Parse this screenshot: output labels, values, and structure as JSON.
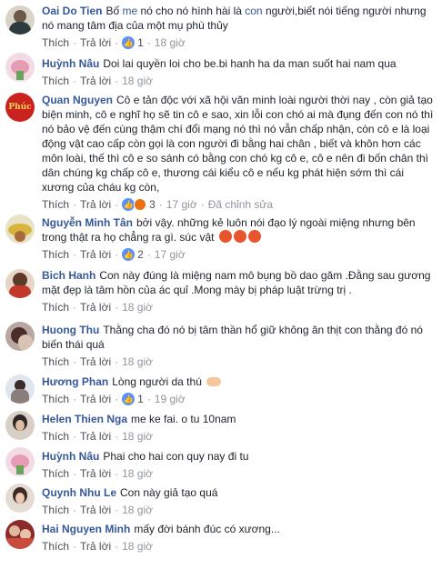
{
  "actions": {
    "like": "Thích",
    "reply": "Trả lời",
    "sep": "·",
    "edited": "Đã chỉnh sửa"
  },
  "comments": [
    {
      "author": "Oai Do Tien",
      "text_parts": [
        "Bố ",
        "me",
        " nó cho nó hình hài là ",
        "con",
        " người,biết nói tiếng người nhưng nó mang tâm địa của một mụ phù thủy"
      ],
      "like_count": "1",
      "time": "18 giờ"
    },
    {
      "author": "Huỳnh Nâu",
      "text": "Doi lai quyền loi cho be.bi hanh ha da man suốt hai nam qua",
      "time": "18 giờ"
    },
    {
      "author": "Quan Nguyen",
      "text": "Cô e tản độc với xã hội văn minh loài người thời nay , còn giả tạo biện minh, cô e nghĩ họ sẽ tin cô e sao, xin lỗi con chó ai mà đụng đến con nó thì nó bảo vệ đến cùng thậm chí đổi mạng nó thì nó vẫn chấp nhận, còn cô e là loại động vật cao cấp còn gọi là con người đi bằng hai chân , biết và khôn hơn các môn loài, thế thì cô e so sánh có bằng con chó kg cô e, cô e nên đi bốn chân thì dân chúng kg chấp cô e, thương cái kiểu cô e nếu kg phát hiện sớm thì cái xương của cháu kg còn,",
      "like_count": "3",
      "time": "17 giờ",
      "edited": true
    },
    {
      "author": "Nguyễn Minh Tân",
      "text": "bởi vậy. những kẻ luôn nói đạo lý ngoài miệng nhưng bên trong thật ra họ chẳng ra gì. súc vật",
      "like_count": "2",
      "time": "17 giờ"
    },
    {
      "author": "Bich Hanh",
      "text": "Con này đúng là miệng nam mô bụng bồ dao găm .Đằng sau gương mặt đẹp là tâm hồn của ác quỉ .Mong mày bị pháp luật trừng trị .",
      "time": "18 giờ"
    },
    {
      "author": "Huong Thu",
      "text": "Thằng cha đó nó bị tâm thần hổ giữ không ăn thịt con thằng đó nó biến thái quá",
      "time": "18 giờ"
    },
    {
      "author": "Hương Phan",
      "text": "Lòng người da thú",
      "like_count": "1",
      "time": "19 giờ"
    },
    {
      "author": "Helen Thien Nga",
      "text": "me ke fai. o tu 10nam",
      "time": "18 giờ"
    },
    {
      "author": "Huỳnh Nâu",
      "text": "Phai cho hai con quy nay đi tu",
      "time": "18 giờ"
    },
    {
      "author": "Quynh Nhu Le",
      "text": "Con này giả tạo quá",
      "time": "18 giờ"
    },
    {
      "author": "Hai Nguyen Minh",
      "text": "mấy đời bánh đúc có xương...",
      "time": "18 giờ"
    }
  ],
  "avatar_badge_text": "Phúc",
  "colors": {
    "link": "#365899",
    "text": "#1d2129",
    "meta": "#90949c",
    "like_blue": "#5890ff"
  }
}
